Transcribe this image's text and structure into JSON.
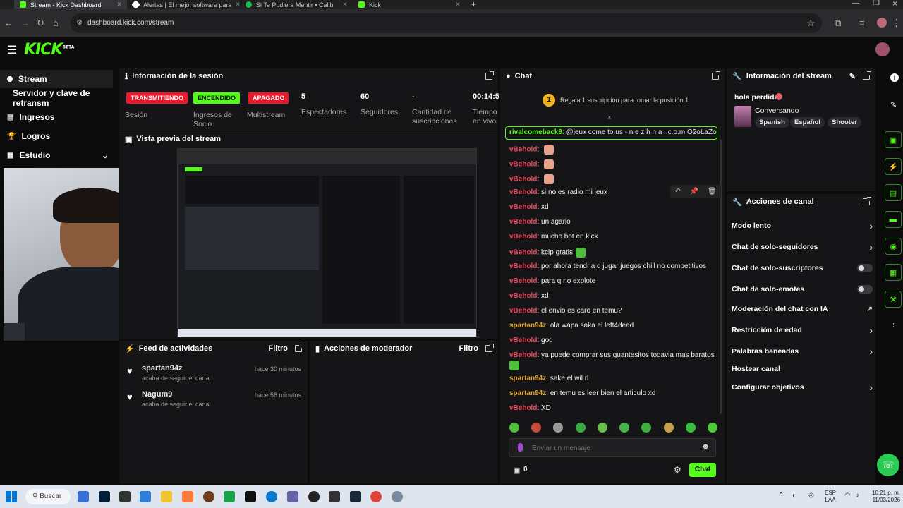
{
  "browser": {
    "tabs": [
      {
        "title": "Stream - Kick Dashboard",
        "active": true
      },
      {
        "title": "Alertas | El mejor software para",
        "active": false
      },
      {
        "title": "Si Te Pudiera Mentir • Calib",
        "active": false
      },
      {
        "title": "Kick",
        "active": false
      }
    ],
    "url": "dashboard.kick.com/stream",
    "new_tab": "+"
  },
  "app": {
    "logo": "KICK",
    "logo_beta": "BETA"
  },
  "sidebar": {
    "items": [
      {
        "label": "Stream"
      },
      {
        "label": "Servidor y clave de retransm"
      },
      {
        "label": "Ingresos"
      },
      {
        "label": "Logros"
      },
      {
        "label": "Estudio"
      }
    ]
  },
  "session": {
    "title": "Información de la sesión",
    "stats": [
      {
        "value": "TRANSMITIENDO",
        "label": "Sesión",
        "kind": "badge",
        "color": "#e8192c"
      },
      {
        "value": "ENCENDIDO",
        "label": "Ingresos de Socio",
        "kind": "badge",
        "color": "#53fc18"
      },
      {
        "value": "APAGADO",
        "label": "Multistream",
        "kind": "badge",
        "color": "#e8192c"
      },
      {
        "value": "5",
        "label": "Espectadores"
      },
      {
        "value": "60",
        "label": "Seguidores"
      },
      {
        "value": "-",
        "label": "Cantidad de suscripciones"
      },
      {
        "value": "00:14:5",
        "label": "Tiempo en vivo"
      }
    ]
  },
  "preview": {
    "title": "Vista previa del stream"
  },
  "feed": {
    "title": "Feed de actividades",
    "filter": "Filtro",
    "items": [
      {
        "user": "spartan94z",
        "action": "acaba de seguir el canal",
        "time": "hace 30 minutos"
      },
      {
        "user": "Nagum9",
        "action": "acaba de seguir el canal",
        "time": "hace 58 minutos"
      }
    ]
  },
  "modactions": {
    "title": "Acciones de moderador",
    "filter": "Filtro"
  },
  "chat": {
    "title": "Chat",
    "promo": "Regala 1 suscripción para tomar la posición 1",
    "promo_rank": "1",
    "pinned": {
      "user": "rivalcomeback9",
      "text": "@jeux come to us - n e z h n a . c.o.m O2oLaZo5o"
    },
    "messages": [
      {
        "user": "vBehold",
        "text": "",
        "emote": true
      },
      {
        "user": "vBehold",
        "text": "",
        "emote": true
      },
      {
        "user": "vBehold",
        "text": "",
        "emote": true
      },
      {
        "user": "vBehold",
        "text": "si no es radio mi jeux"
      },
      {
        "user": "vBehold",
        "text": "xd"
      },
      {
        "user": "vBehold",
        "text": "un agario"
      },
      {
        "user": "vBehold",
        "text": "mucho bot en kick"
      },
      {
        "user": "vBehold",
        "text": "kclp gratis",
        "emote": true
      },
      {
        "user": "vBehold",
        "text": "por ahora tendria q jugar juegos chill no competitivos"
      },
      {
        "user": "vBehold",
        "text": "para q no explote"
      },
      {
        "user": "vBehold",
        "text": "xd"
      },
      {
        "user": "vBehold",
        "text": "el envio es caro en temu?"
      },
      {
        "user": "spartan94z",
        "text": "ola wapa saka el left4dead"
      },
      {
        "user": "vBehold",
        "text": "god"
      },
      {
        "user": "vBehold",
        "text": "ya puede comprar sus guantesitos todavia mas baratos"
      },
      {
        "user": "spartan94z",
        "text": "sake el wil rl"
      },
      {
        "user": "spartan94z",
        "text": "en temu es leer bien el articulo xd"
      },
      {
        "user": "vBehold",
        "text": "XD"
      }
    ],
    "input_placeholder": "Enviar un mensaje",
    "points": "0",
    "send_label": "Chat",
    "colors": {
      "vBehold": "#e8455a",
      "spartan94z": "#e0a030",
      "rivalcomeback9": "#53fc18"
    }
  },
  "streaminfo": {
    "title": "Información del stream",
    "stream_title": "hola perdida",
    "category": "Conversando",
    "tags": [
      "Spanish",
      "Español",
      "Shooter"
    ]
  },
  "channel_actions": {
    "title": "Acciones de canal",
    "items": [
      {
        "label": "Modo lento",
        "control": "chevron"
      },
      {
        "label": "Chat de solo-seguidores",
        "control": "chevron"
      },
      {
        "label": "Chat de solo-suscriptores",
        "control": "toggle"
      },
      {
        "label": "Chat de solo-emotes",
        "control": "toggle"
      },
      {
        "label": "Moderación del chat con IA",
        "control": "external"
      },
      {
        "label": "Restricción de edad",
        "control": "chevron"
      },
      {
        "label": "Palabras baneadas",
        "control": "chevron"
      },
      {
        "label": "Hostear canal",
        "control": "none"
      },
      {
        "label": "Configurar objetivos",
        "control": "chevron"
      }
    ]
  },
  "taskbar": {
    "search": "Buscar",
    "lang": "ESP",
    "lang2": "LAA",
    "time": "10:21 p. m.",
    "date": "11/03/2026"
  }
}
